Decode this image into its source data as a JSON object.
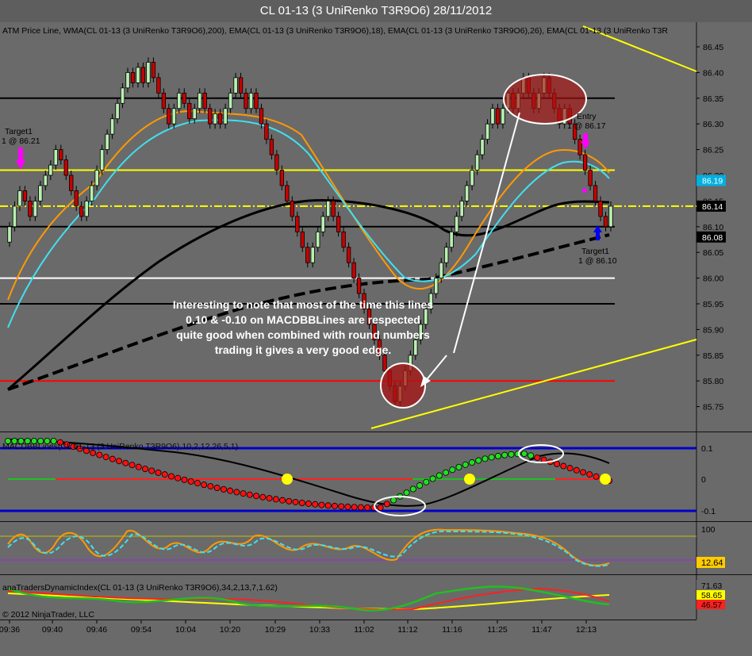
{
  "window": {
    "title": "CL 01-13 (3 UniRenko T3R9O6)  28/11/2012"
  },
  "panels": {
    "price": {
      "header": "ATM Price Line, WMA(CL 01-13 (3 UniRenko T3R9O6),200), EMA(CL 01-13 (3 UniRenko T3R9O6),18), EMA(CL 01-13 (3 UniRenko T3R9O6),26), EMA(CL 01-13 (3 UniRenko T3R",
      "ticks": [
        "86.45",
        "86.40",
        "86.35",
        "86.30",
        "86.25",
        "86.20",
        "86.15",
        "86.10",
        "86.05",
        "86.00",
        "85.95",
        "85.90",
        "85.85",
        "85.80",
        "85.75"
      ],
      "badges": [
        {
          "value": "86.19",
          "bg": "#00b0e0",
          "fg": "#ffffff"
        },
        {
          "value": "86.14",
          "bg": "#000000",
          "fg": "#ffffff"
        },
        {
          "value": "86.08",
          "bg": "#000000",
          "fg": "#ffffff"
        }
      ],
      "labels": {
        "target1_left_a": "Target1",
        "target1_left_b": "1 @ 86.21",
        "entry_a": "Entry",
        "entry_b": "1 @ 86.17",
        "target1_right_a": "Target1",
        "target1_right_b": "1 @ 86.10"
      },
      "annotation": [
        "Interesting to note that most of the time this lines",
        "0.10 & -0.10 on MACDBBLines are respected",
        "quite good when combined with round numbers",
        "trading it gives a very good edge."
      ]
    },
    "macd": {
      "header": "MACDBBLines(CL 01-13 (3 UniRenko T3R9O6),10,2,12,26,5,1)",
      "ticks": [
        "0.1",
        "0",
        "-0.1"
      ]
    },
    "stoch": {
      "ticks": [
        "100"
      ],
      "badge": "12.64"
    },
    "tdi": {
      "header": "anaTradersDynamicIndex(CL 01-13 (3 UniRenko T3R9O6),34,2,13,7,1.62)",
      "badges": [
        "71.63",
        "58.65",
        "46.57"
      ],
      "copyright": "© 2012 NinjaTrader, LLC"
    }
  },
  "x_axis": [
    "09:36",
    "09:40",
    "09:46",
    "09:54",
    "10:04",
    "10:20",
    "10:29",
    "10:33",
    "11:02",
    "11:12",
    "11:16",
    "11:25",
    "11:47",
    "12:13"
  ],
  "chart_data": {
    "type": "candlestick",
    "title": "CL 01-13 (3 UniRenko T3R9O6)  28/11/2012",
    "ylim": [
      85.72,
      86.47
    ],
    "x_labels": [
      "09:36",
      "09:40",
      "09:46",
      "09:54",
      "10:04",
      "10:20",
      "10:29",
      "10:33",
      "11:02",
      "11:12",
      "11:16",
      "11:25",
      "11:47",
      "12:13"
    ],
    "closes": [
      86.1,
      86.14,
      86.17,
      86.15,
      86.12,
      86.15,
      86.18,
      86.2,
      86.22,
      86.25,
      86.23,
      86.2,
      86.17,
      86.14,
      86.12,
      86.15,
      86.18,
      86.21,
      86.25,
      86.28,
      86.31,
      86.34,
      86.37,
      86.4,
      86.38,
      86.41,
      86.38,
      86.42,
      86.39,
      86.36,
      86.33,
      86.3,
      86.33,
      86.36,
      86.34,
      86.31,
      86.33,
      86.36,
      86.33,
      86.3,
      86.32,
      86.3,
      86.33,
      86.36,
      86.39,
      86.36,
      86.33,
      86.36,
      86.33,
      86.3,
      86.27,
      86.24,
      86.21,
      86.18,
      86.15,
      86.12,
      86.09,
      86.06,
      86.03,
      86.06,
      86.09,
      86.12,
      86.15,
      86.12,
      86.09,
      86.06,
      86.03,
      86.0,
      85.97,
      85.94,
      85.91,
      85.88,
      85.85,
      85.82,
      85.79,
      85.76,
      85.79,
      85.82,
      85.85,
      85.88,
      85.91,
      85.94,
      85.97,
      86.0,
      86.03,
      86.06,
      86.09,
      86.12,
      86.15,
      86.18,
      86.21,
      86.24,
      86.27,
      86.3,
      86.33,
      86.3,
      86.33,
      86.36,
      86.33,
      86.36,
      86.39,
      86.36,
      86.33,
      86.36,
      86.39,
      86.36,
      86.33,
      86.3,
      86.33,
      86.3,
      86.27,
      86.24,
      86.21,
      86.18,
      86.15,
      86.12,
      86.1,
      86.14
    ],
    "horizontal_lines": [
      {
        "value": 86.35,
        "color": "#000000"
      },
      {
        "value": 86.21,
        "color": "#ffff00"
      },
      {
        "value": 86.14,
        "color": "#ffff00",
        "style": "dash-dot"
      },
      {
        "value": 86.1,
        "color": "#000000"
      },
      {
        "value": 86.0,
        "color": "#ffffff"
      },
      {
        "value": 85.95,
        "color": "#000000"
      },
      {
        "value": 85.8,
        "color": "#ff0000"
      }
    ],
    "series": [
      {
        "name": "WMA 200",
        "color": "#000000"
      },
      {
        "name": "EMA 18",
        "color": "#ff9900"
      },
      {
        "name": "EMA 26",
        "color": "#40e0f0"
      }
    ],
    "macd_levels": [
      0.1,
      0,
      -0.1
    ],
    "stoch_level": 12.64,
    "tdi_levels": [
      71.63,
      58.65,
      46.57
    ]
  }
}
